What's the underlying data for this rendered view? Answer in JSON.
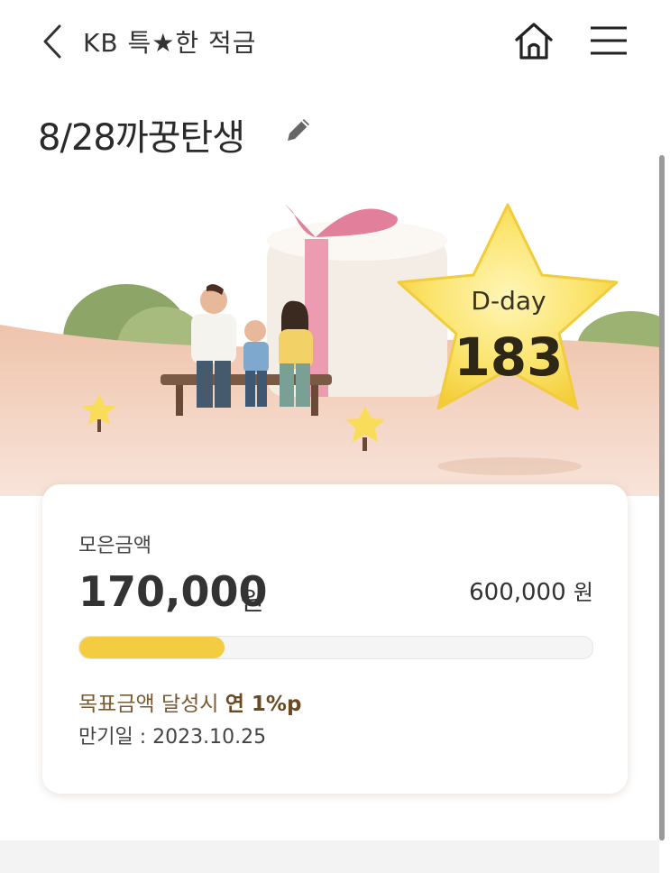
{
  "header": {
    "title": "KB 특★한 적금",
    "back_icon": "chevron-left-icon",
    "home_icon": "home-icon",
    "menu_icon": "menu-icon"
  },
  "page": {
    "title": "8/28까꿍탄생",
    "edit_icon": "pencil-icon"
  },
  "hero": {
    "dday_label": "D-day",
    "dday_value": "183"
  },
  "savings": {
    "label": "모은금액",
    "amount": "170,000",
    "amount_unit": "원",
    "goal_amount": "600,000",
    "goal_unit": "원",
    "progress_fraction": 0.283,
    "benefit_prefix": "목표금액 달성시 ",
    "benefit_rate": "연 1%p",
    "maturity": "만기일 : 2023.10.25"
  },
  "colors": {
    "accent_yellow": "#f4cc42",
    "benefit_text": "#7a5a32",
    "hero_background": "#f7ddd0"
  }
}
